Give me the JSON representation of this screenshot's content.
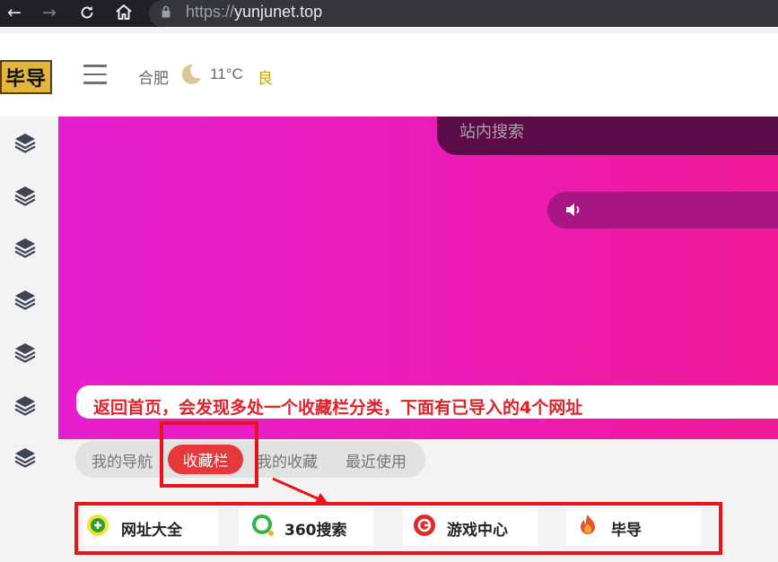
{
  "browser": {
    "url_scheme": "https://",
    "url_host": "yunjunet.top"
  },
  "header": {
    "logo_text": "毕导",
    "city": "合肥",
    "weather_icon": "crescent-moon-icon",
    "temperature": "11°C",
    "air_quality": "良"
  },
  "banner": {
    "search_placeholder": "站内搜索",
    "annotation": "返回首页，会发现多处一个收藏栏分类，下面有已导入的4个网址"
  },
  "tabs": {
    "items": [
      "我的导航",
      "收藏栏",
      "我的收藏",
      "最近使用"
    ],
    "active": "收藏栏"
  },
  "bookmarks": [
    {
      "label": "网址大全",
      "icon": "360-navigation-icon"
    },
    {
      "label": "360搜索",
      "icon": "360-search-icon"
    },
    {
      "label": "游戏中心",
      "icon": "game-center-icon"
    },
    {
      "label": "毕导",
      "icon": "flame-icon"
    }
  ],
  "colors": {
    "banner_start": "#e51fcf",
    "banner_end": "#f01a97",
    "active_tab": "#e5383b",
    "annotation_red": "#e8141c",
    "aqi_text": "#c6a400"
  }
}
